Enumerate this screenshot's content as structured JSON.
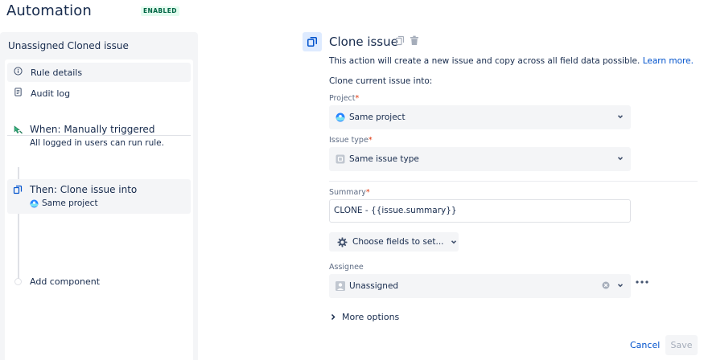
{
  "header": {
    "title": "Automation",
    "status": "ENABLED"
  },
  "sidebar": {
    "rule_name": "Unassigned Cloned issue",
    "nav": [
      {
        "label": "Rule details",
        "icon": "info-icon"
      },
      {
        "label": "Audit log",
        "icon": "document-icon"
      }
    ],
    "steps": [
      {
        "title": "When: Manually triggered",
        "subtitle": "All logged in users can run rule.",
        "icon": "pointer-trigger-icon"
      },
      {
        "title": "Then: Clone issue into",
        "subtitle": "Same project",
        "icon": "clone-icon"
      }
    ],
    "add_component": "Add component"
  },
  "main": {
    "title": "Clone issue",
    "description": "This action will create a new issue and copy across all field data possible.",
    "learn_more": "Learn more.",
    "clone_into_label": "Clone current issue into:",
    "project": {
      "label": "Project",
      "value": "Same project"
    },
    "issue_type": {
      "label": "Issue type",
      "value": "Same issue type"
    },
    "summary": {
      "label": "Summary",
      "value": "CLONE - {{issue.summary}}"
    },
    "choose_fields": "Choose fields to set...",
    "assignee": {
      "label": "Assignee",
      "value": "Unassigned"
    },
    "more_options": "More options",
    "cancel": "Cancel",
    "save": "Save"
  },
  "colors": {
    "accent": "#0052cc",
    "enabled_text": "#006644",
    "enabled_bg": "#e3fcef",
    "required": "#de350b"
  }
}
